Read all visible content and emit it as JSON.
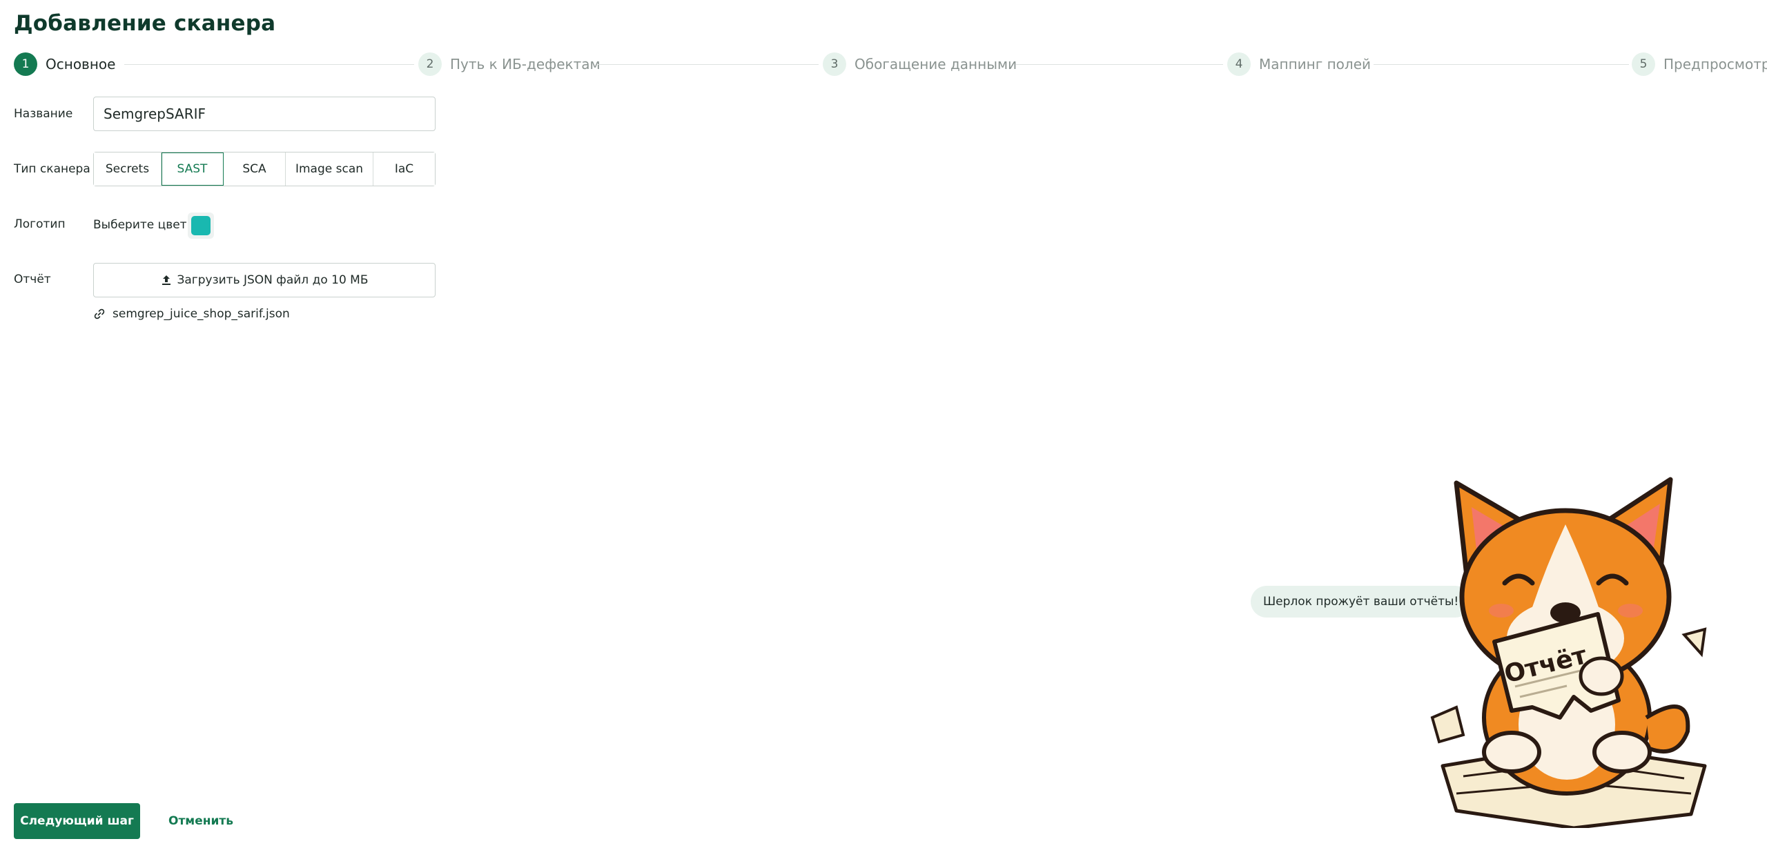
{
  "page": {
    "title": "Добавление сканера"
  },
  "stepper": {
    "steps": [
      {
        "num": "1",
        "label": "Основное",
        "active": true
      },
      {
        "num": "2",
        "label": "Путь к ИБ-дефектам",
        "active": false
      },
      {
        "num": "3",
        "label": "Обогащение данными",
        "active": false
      },
      {
        "num": "4",
        "label": "Маппинг полей",
        "active": false
      },
      {
        "num": "5",
        "label": "Предпросмотр",
        "active": false
      }
    ]
  },
  "form": {
    "name": {
      "label": "Название",
      "value": "SemgrepSARIF"
    },
    "scanner_type": {
      "label": "Тип сканера",
      "options": [
        "Secrets",
        "SAST",
        "SCA",
        "Image scan",
        "IaC"
      ],
      "selected": "SAST"
    },
    "logo": {
      "label": "Логотип",
      "color_label": "Выберите цвет",
      "color": "#19b8b0"
    },
    "report": {
      "label": "Отчёт",
      "upload_label": "Загрузить JSON файл до 10 МБ",
      "file_name": "semgrep_juice_shop_sarif.json"
    }
  },
  "actions": {
    "next_label": "Следующий шаг",
    "cancel_label": "Отменить"
  },
  "mascot": {
    "speech": "Шерлок прожуёт ваши отчёты!",
    "paper_text": "Отчёт"
  },
  "colors": {
    "primary": "#147a52",
    "step_bg": "#e6f2ec",
    "accent_swatch": "#19b8b0"
  }
}
